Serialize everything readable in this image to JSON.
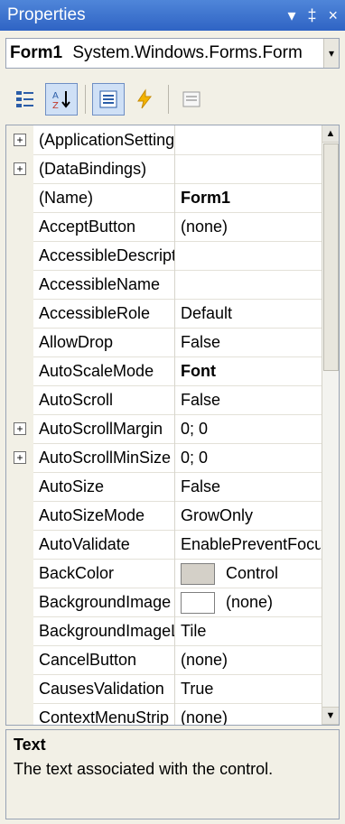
{
  "window": {
    "title": "Properties",
    "controls": "▾ ‡ ×"
  },
  "object_selector": {
    "name": "Form1",
    "type": "System.Windows.Forms.Form",
    "dropdown": "▾"
  },
  "toolbar": {
    "categorized_icon": "categorized-icon",
    "alphabetical_icon": "alphabetical-icon",
    "properties_icon": "properties-icon",
    "events_icon": "events-icon",
    "property_pages_icon": "property-pages-icon"
  },
  "grid": {
    "rows": [
      {
        "expander": "+",
        "name": "(ApplicationSettings)",
        "value": ""
      },
      {
        "expander": "+",
        "name": "(DataBindings)",
        "value": ""
      },
      {
        "expander": "",
        "name": "(Name)",
        "value": "Form1",
        "bold": true
      },
      {
        "expander": "",
        "name": "AcceptButton",
        "value": "(none)"
      },
      {
        "expander": "",
        "name": "AccessibleDescription",
        "value": ""
      },
      {
        "expander": "",
        "name": "AccessibleName",
        "value": ""
      },
      {
        "expander": "",
        "name": "AccessibleRole",
        "value": "Default"
      },
      {
        "expander": "",
        "name": "AllowDrop",
        "value": "False"
      },
      {
        "expander": "",
        "name": "AutoScaleMode",
        "value": "Font",
        "bold": true
      },
      {
        "expander": "",
        "name": "AutoScroll",
        "value": "False"
      },
      {
        "expander": "+",
        "name": "AutoScrollMargin",
        "value": "0; 0"
      },
      {
        "expander": "+",
        "name": "AutoScrollMinSize",
        "value": "0; 0"
      },
      {
        "expander": "",
        "name": "AutoSize",
        "value": "False"
      },
      {
        "expander": "",
        "name": "AutoSizeMode",
        "value": "GrowOnly"
      },
      {
        "expander": "",
        "name": "AutoValidate",
        "value": "EnablePreventFocusChange"
      },
      {
        "expander": "",
        "name": "BackColor",
        "value": "Control",
        "swatch": "#d4d0c8"
      },
      {
        "expander": "",
        "name": "BackgroundImage",
        "value": "(none)",
        "swatch": "#ffffff"
      },
      {
        "expander": "",
        "name": "BackgroundImageLayout",
        "value": "Tile"
      },
      {
        "expander": "",
        "name": "CancelButton",
        "value": "(none)"
      },
      {
        "expander": "",
        "name": "CausesValidation",
        "value": "True"
      },
      {
        "expander": "",
        "name": "ContextMenuStrip",
        "value": "(none)"
      }
    ]
  },
  "description": {
    "title": "Text",
    "text": "The text associated with the control."
  }
}
